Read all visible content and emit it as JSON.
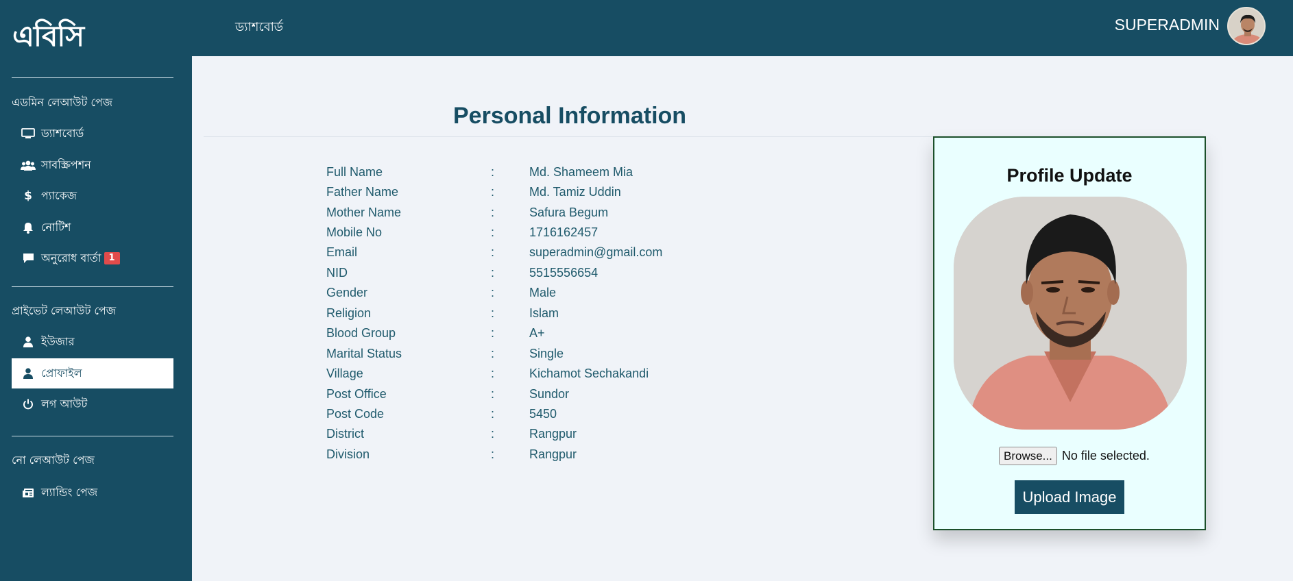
{
  "header": {
    "brand": "এবিসি",
    "breadcrumb": "ড্যাশবোর্ড",
    "user_name": "SUPERADMIN"
  },
  "sidebar": {
    "sections": [
      {
        "title": "এডমিন লেআউট পেজ",
        "items": [
          {
            "label": "ড্যাশবোর্ড",
            "icon": "monitor-icon"
          },
          {
            "label": "সাবস্ক্রিপশন",
            "icon": "users-icon"
          },
          {
            "label": "প্যাকেজ",
            "icon": "dollar-icon"
          },
          {
            "label": "নোটিশ",
            "icon": "bell-icon"
          },
          {
            "label": "অনুরোধ বার্তা",
            "icon": "comment-icon",
            "badge": "1"
          }
        ]
      },
      {
        "title": "প্রাইভেট লেআউট পেজ",
        "items": [
          {
            "label": "ইউজার",
            "icon": "user-icon"
          },
          {
            "label": "প্রোফাইল",
            "icon": "user-icon",
            "active": true
          },
          {
            "label": "লগ আউট",
            "icon": "power-icon"
          }
        ]
      },
      {
        "title": "নো লেআউট পেজ",
        "items": [
          {
            "label": "ল্যান্ডিং পেজ",
            "icon": "newspaper-icon"
          }
        ]
      }
    ]
  },
  "main": {
    "title": "Personal Information",
    "fields": [
      {
        "label": "Full Name",
        "value": "Md. Shameem Mia"
      },
      {
        "label": "Father Name",
        "value": "Md. Tamiz Uddin"
      },
      {
        "label": "Mother Name",
        "value": "Safura Begum"
      },
      {
        "label": "Mobile No",
        "value": "1716162457"
      },
      {
        "label": "Email",
        "value": "superadmin@gmail.com"
      },
      {
        "label": "NID",
        "value": "5515556654"
      },
      {
        "label": "Gender",
        "value": "Male"
      },
      {
        "label": "Religion",
        "value": "Islam"
      },
      {
        "label": "Blood Group",
        "value": "A+"
      },
      {
        "label": "Marital Status",
        "value": "Single"
      },
      {
        "label": "Village",
        "value": "Kichamot Sechakandi"
      },
      {
        "label": "Post Office",
        "value": "Sundor"
      },
      {
        "label": "Post Code",
        "value": "5450"
      },
      {
        "label": "District",
        "value": "Rangpur"
      },
      {
        "label": "Division",
        "value": "Rangpur"
      }
    ],
    "separator": ":"
  },
  "profile_card": {
    "title": "Profile Update",
    "browse_label": "Browse...",
    "file_status": "No file selected.",
    "upload_label": "Upload Image"
  },
  "colors": {
    "primary": "#174d63",
    "card_bg": "#eaffff",
    "badge": "#e14b4b",
    "page_bg": "#f0f3f8"
  }
}
